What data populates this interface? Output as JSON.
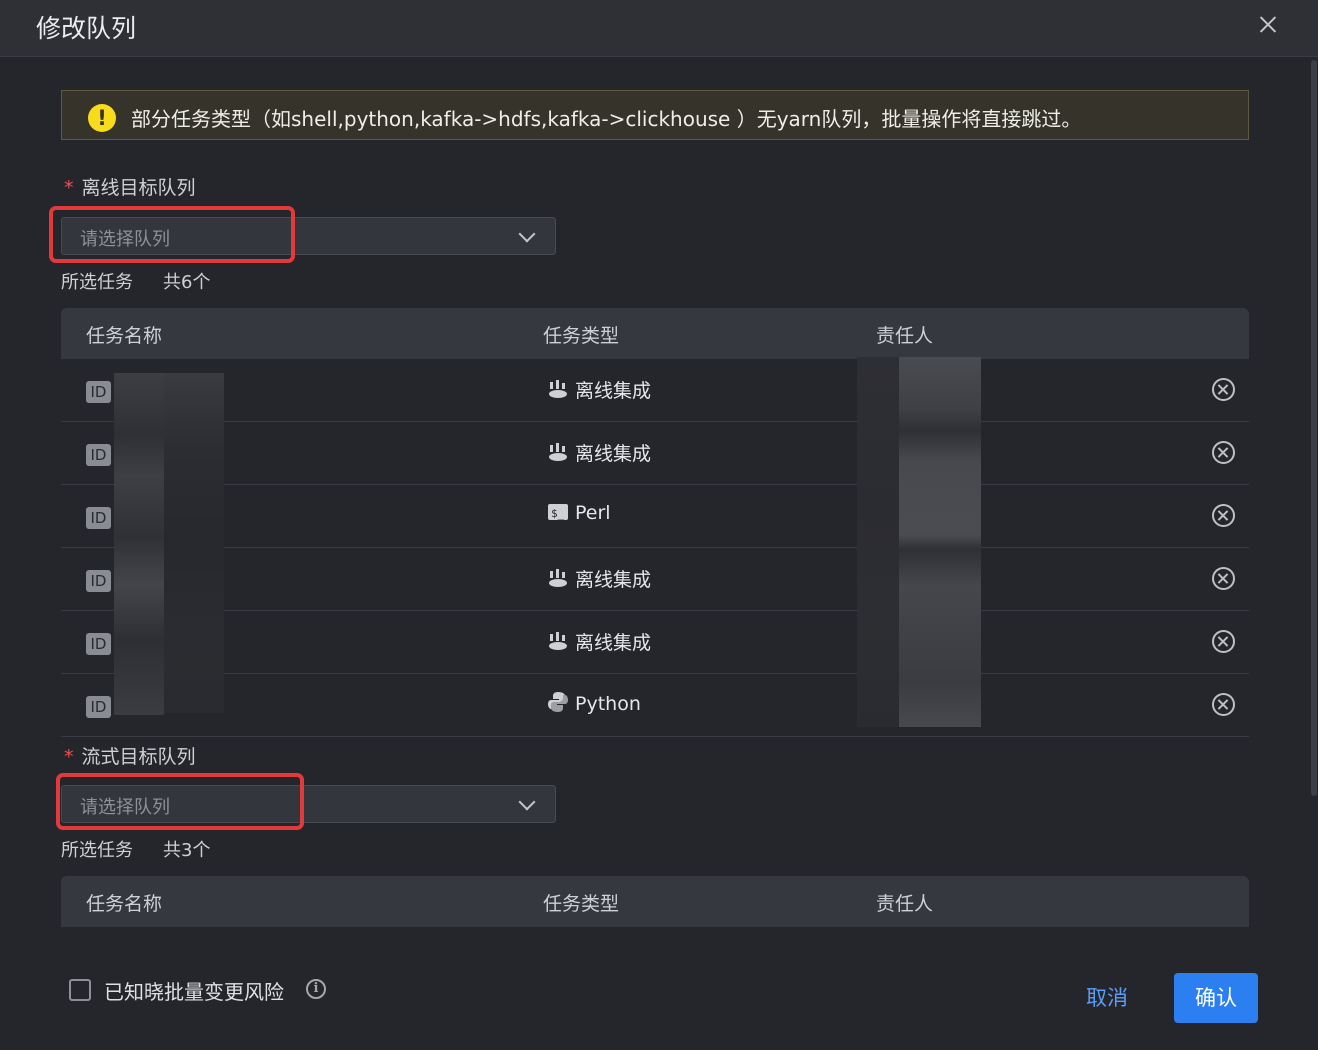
{
  "dialog": {
    "title": "修改队列"
  },
  "alert": {
    "icon": "warning-icon",
    "text": "部分任务类型（如shell,python,kafka->hdfs,kafka->clickhouse ）无yarn队列，批量操作将直接跳过。"
  },
  "offline": {
    "label": "离线目标队列",
    "placeholder": "请选择队列",
    "summary_label": "所选任务",
    "summary_count": "共6个",
    "columns": [
      "任务名称",
      "任务类型",
      "责任人"
    ],
    "rows": [
      {
        "id_badge": "ID",
        "type": "离线集成",
        "type_icon": "offline-integration-icon"
      },
      {
        "id_badge": "ID",
        "type": "离线集成",
        "type_icon": "offline-integration-icon"
      },
      {
        "id_badge": "ID",
        "type": "Perl",
        "type_icon": "terminal-icon"
      },
      {
        "id_badge": "ID",
        "type": "离线集成",
        "type_icon": "offline-integration-icon"
      },
      {
        "id_badge": "ID",
        "type": "离线集成",
        "type_icon": "offline-integration-icon"
      },
      {
        "id_badge": "ID",
        "type": "Python",
        "type_icon": "python-icon"
      }
    ]
  },
  "streaming": {
    "label": "流式目标队列",
    "placeholder": "请选择队列",
    "summary_label": "所选任务",
    "summary_count": "共3个",
    "columns": [
      "任务名称",
      "任务类型",
      "责任人"
    ]
  },
  "footer": {
    "checkbox_label": "已知晓批量变更风险",
    "info_icon": "i",
    "cancel": "取消",
    "confirm": "确认"
  },
  "colors": {
    "accent": "#2c7ff0",
    "warning": "#f8dc1c",
    "required": "#f05050",
    "highlight": "#e23a3a"
  }
}
